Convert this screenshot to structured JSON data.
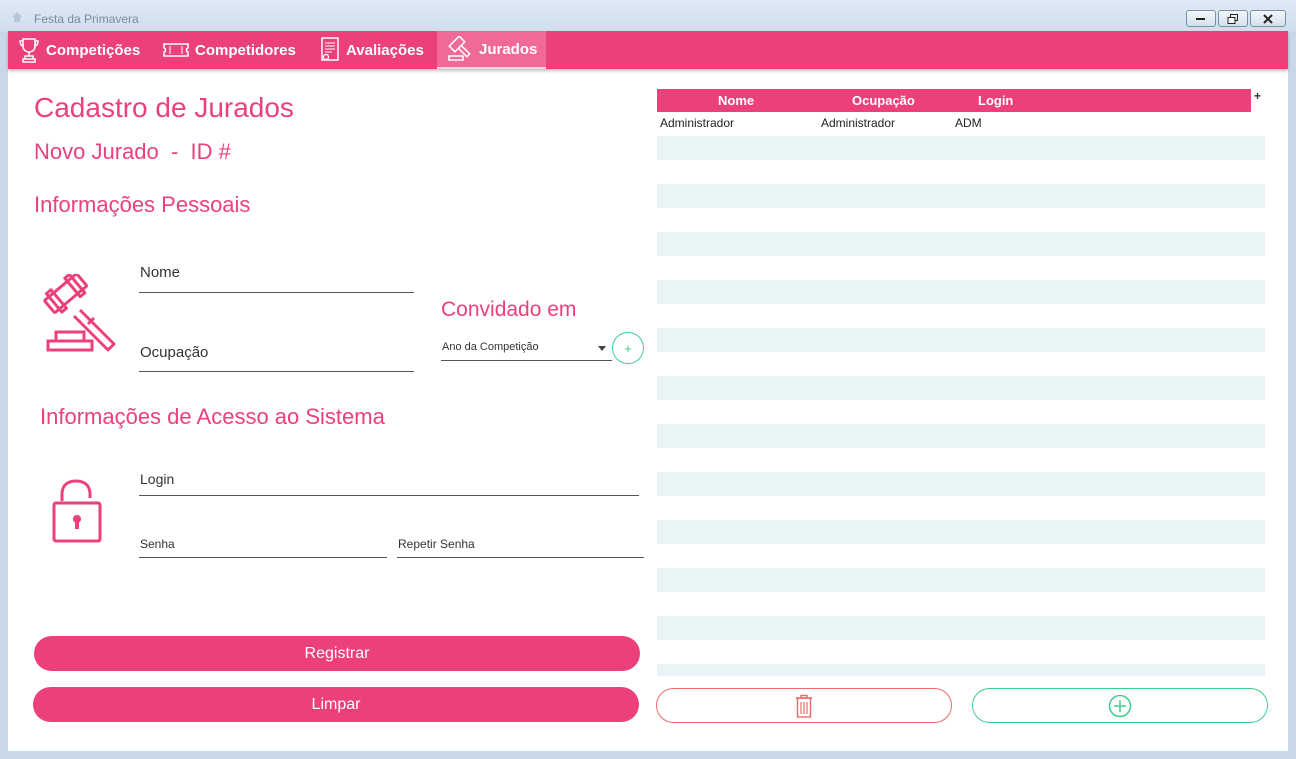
{
  "window": {
    "title": "Festa da Primavera"
  },
  "nav": {
    "tabs": [
      {
        "label": "Competições",
        "icon": "trophy-icon"
      },
      {
        "label": "Competidores",
        "icon": "ticket-icon"
      },
      {
        "label": "Avaliações",
        "icon": "document-icon"
      },
      {
        "label": "Jurados",
        "icon": "gavel-icon",
        "active": true
      }
    ]
  },
  "form": {
    "title": "Cadastro de Jurados",
    "subtitle": "Novo Jurado  -  ID #",
    "personal_section": "Informações Pessoais",
    "nome_label": "Nome",
    "ocupacao_label": "Ocupação",
    "convidado_title": "Convidado em",
    "ano_placeholder": "Ano da Competição",
    "add_year_label": "+",
    "access_section": "Informações de Acesso ao Sistema",
    "login_label": "Login",
    "senha_label": "Senha",
    "repetir_label": "Repetir Senha",
    "register_button": "Registrar",
    "clear_button": "Limpar"
  },
  "table": {
    "columns": [
      "Nome",
      "Ocupação",
      "Login"
    ],
    "add_column_symbol": "+",
    "rows": [
      [
        "Administrador",
        "Administrador",
        "ADM"
      ]
    ]
  },
  "colors": {
    "accent": "#ec407a",
    "delete": "#e86a6a",
    "add": "#3ccf8e",
    "row_alt": "#e9f4f6"
  }
}
